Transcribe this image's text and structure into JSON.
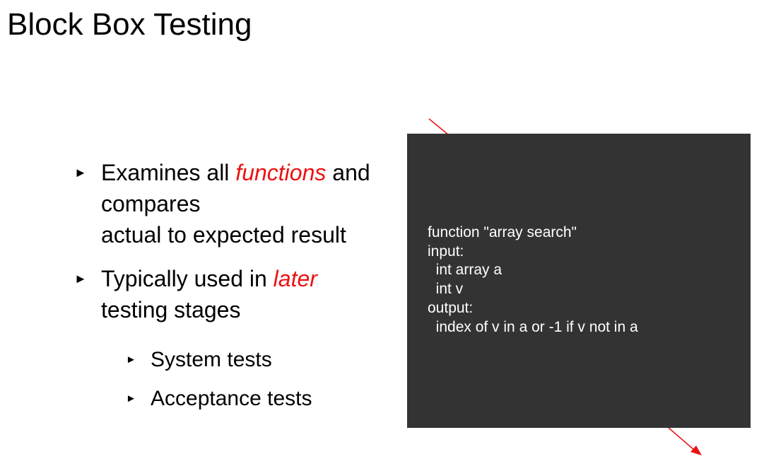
{
  "slide": {
    "title": "Block Box Testing",
    "bullet_marker": "►",
    "bullets": [
      {
        "before": "Examines all ",
        "emphasis": "functions",
        "after": " and",
        "line2": "compares",
        "line3": "actual to expected result"
      },
      {
        "before": "Typically used in ",
        "emphasis": "later",
        "line2": "testing stages"
      }
    ],
    "sub_bullets": [
      "System tests",
      "Acceptance tests"
    ]
  },
  "code_box": {
    "lines": [
      "function \"array search\"",
      "input:",
      "  int array a",
      "  int v",
      "output:",
      "  index of v in a or -1 if v not in a"
    ]
  },
  "colors": {
    "emphasis": "#ee1111",
    "arrow": "#ee1111",
    "box_background": "#333333"
  }
}
